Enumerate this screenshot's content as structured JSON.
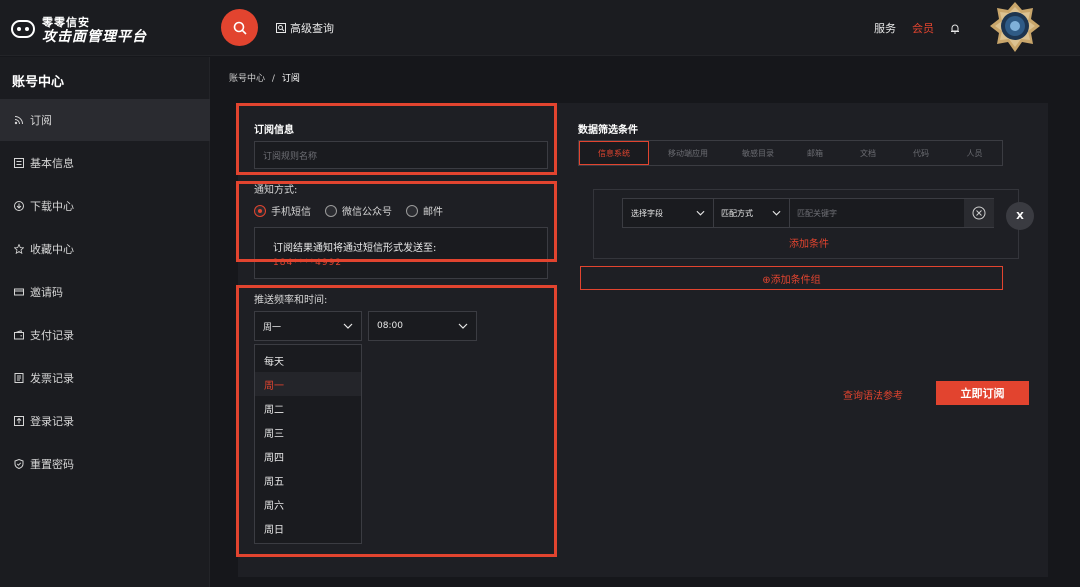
{
  "header": {
    "logo_line1": "零零信安",
    "logo_line2": "攻击面管理平台",
    "advanced_query": "高级查询",
    "service": "服务",
    "member": "会员"
  },
  "sidebar": {
    "title": "账号中心",
    "items": [
      {
        "label": "订阅",
        "icon": "rss-icon"
      },
      {
        "label": "基本信息",
        "icon": "id-card-icon"
      },
      {
        "label": "下载中心",
        "icon": "download-icon"
      },
      {
        "label": "收藏中心",
        "icon": "star-icon"
      },
      {
        "label": "邀请码",
        "icon": "ticket-icon"
      },
      {
        "label": "支付记录",
        "icon": "wallet-icon"
      },
      {
        "label": "发票记录",
        "icon": "invoice-icon"
      },
      {
        "label": "登录记录",
        "icon": "login-icon"
      },
      {
        "label": "重置密码",
        "icon": "shield-icon"
      }
    ]
  },
  "breadcrumb": {
    "root": "账号中心",
    "sep": "/",
    "current": "订阅"
  },
  "subscription": {
    "title": "订阅信息",
    "name_placeholder": "订阅规则名称",
    "notify_label": "通知方式:",
    "notify_options": [
      "手机短信",
      "微信公众号",
      "邮件"
    ],
    "notice_text": "订阅结果通知将通过短信形式发送至:",
    "notice_phone": "184****4992",
    "freq_label": "推送频率和时间:",
    "freq_value": "周一",
    "time_value": "08:00",
    "freq_options": [
      "每天",
      "周一",
      "周二",
      "周三",
      "周四",
      "周五",
      "周六",
      "周日"
    ]
  },
  "filter": {
    "title": "数据筛选条件",
    "tabs": [
      "信息系统",
      "移动端应用",
      "敏感目录",
      "邮箱",
      "文档",
      "代码",
      "人员"
    ],
    "select_field": "选择字段",
    "match_mode": "匹配方式",
    "keyword_placeholder": "匹配关键字",
    "remove_label": "X",
    "add_condition": "添加条件",
    "add_group": "⊕添加条件组"
  },
  "actions": {
    "syntax_ref": "查询语法参考",
    "subscribe": "立即订阅"
  },
  "colors": {
    "accent": "#e2442f",
    "bg": "#16171b",
    "panel": "#1e1f24"
  }
}
